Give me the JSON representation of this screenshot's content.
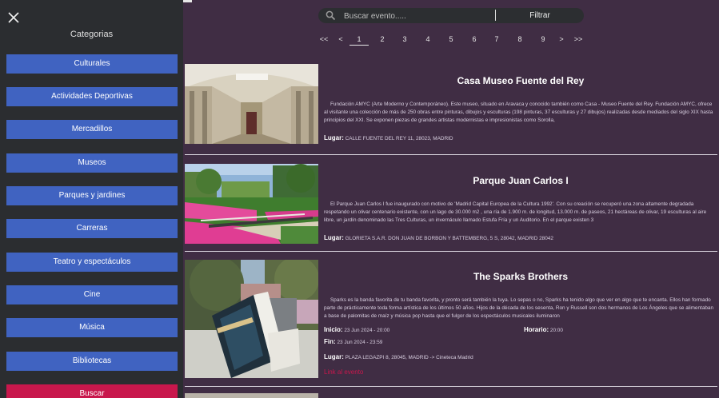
{
  "sidebar": {
    "title": "Categorias",
    "categories": [
      "Culturales",
      "Actividades Deportivas",
      "Mercadillos",
      "Museos",
      "Parques y jardines",
      "Carreras",
      "Teatro y espectáculos",
      "Cine",
      "Música",
      "Bibliotecas"
    ],
    "search_label": "Buscar"
  },
  "search": {
    "placeholder": "Buscar evento.....",
    "value": "",
    "filter_label": "Filtrar"
  },
  "pagination": {
    "first": "<<",
    "prev": "<",
    "pages": [
      "1",
      "2",
      "3",
      "4",
      "5",
      "6",
      "7",
      "8",
      "9"
    ],
    "current": "1",
    "next": ">",
    "last": ">>"
  },
  "events": [
    {
      "title": "Casa Museo Fuente del Rey",
      "description": "Fundación AMYC (Arte Moderno y Contemporáneo). Este museo, situado en Aravaca y conocido también como Casa - Museo Fuente del Rey. Fundación AMYC, ofrece al visitante una colección de más de 250 obras entre pinturas, dibujos y esculturas (198 pinturas, 37 esculturas y 27 dibujos) realizadas desde mediados del siglo XIX hasta principios del XXI. Se exponen piezas de grandes artistas modernistas e impresionistas como Sorolla,",
      "location_label": "Lugar:",
      "location": "CALLE FUENTE DEL REY 11, 28023, MADRID"
    },
    {
      "title": "Parque Juan Carlos I",
      "description": "El Parque Juan Carlos I fue inaugurado con motivo de 'Madrid Capital Europea de la Cultura 1992'. Con su creación se recuperó una zona altamente degradada respetando un olivar centenario existente, con un lago de 30.000 m2 , una ría de 1.900 m. de longitud, 13.000 m. de paseos, 21 hectáreas de olivar, 19 esculturas al aire libre, un jardín denominado las Tres Culturas, un invernáculo llamado Estufa Fría y un Auditorio. En el parque existen 3",
      "location_label": "Lugar:",
      "location": "GLORIETA S.A.R. DON JUAN DE BORBON Y BATTEMBERG, 5 S, 28042, MADRID 28042"
    },
    {
      "title": "The Sparks Brothers",
      "description": "Sparks es la banda favorita de tu banda favorita, y pronto será también la tuya. Lo sepas o no, Sparks ha tenido algo que ver en algo que te encanta. Ellos han formado parte de prácticamente toda forma artística de los últimos 50 años. Hijos de la década de los sesenta, Ron y Russell son dos hermanos de Los Ángeles que se alimentaban a base de palomitas de maíz y música pop hasta que el fulgor de los espectáculos musicales iluminaron",
      "start_label": "Inicio:",
      "start": "23 Jun 2024 - 20:00",
      "time_label": "Horario:",
      "time": "20:00",
      "end_label": "Fin:",
      "end": "23 Jun 2024 - 23:59",
      "location_label": "Lugar:",
      "location": "PLAZA LEGAZPI 8, 28045, MADRID -> Cineteca Madrid",
      "link_label": "Link al evento"
    }
  ],
  "colors": {
    "background": "#402d44",
    "sidebar": "#2b2d30",
    "category_button": "#4063c1",
    "search_button": "#c8174c",
    "link": "#c8174c"
  }
}
